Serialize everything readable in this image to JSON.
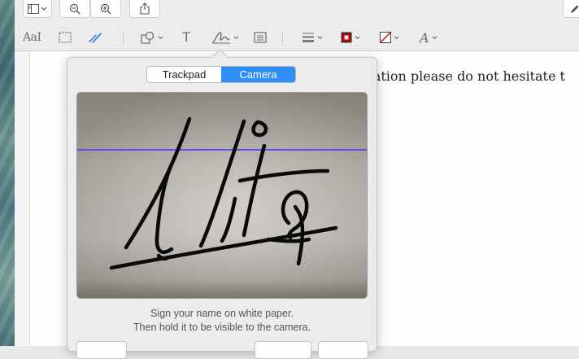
{
  "icons": {
    "sidebar": "sidebar-icon",
    "zoom_out": "zoom-out-icon",
    "zoom_in": "zoom-in-icon",
    "share": "share-icon",
    "edit": "pencil-icon",
    "text_style": "text-style-icon",
    "selection": "rectangle-selection-icon",
    "sketch": "sketch-icon",
    "shapes": "shapes-icon",
    "text": "text-icon",
    "sign": "signature-icon",
    "note": "note-icon",
    "line_style": "line-style-icon",
    "border_color": "border-color-icon",
    "fill_color": "fill-color-icon",
    "font": "font-icon"
  },
  "markup_toolbar": {
    "text_style_label": "AaI",
    "text_tool_label": "T",
    "font_label": "A"
  },
  "colors": {
    "accent": "#2f8ef7",
    "border_color": "#c00000",
    "sketch": "#2f6fe0",
    "camera_guide": "#5b4ff0"
  },
  "document": {
    "visible_text": "rmation please do not hesitate t"
  },
  "signature_popover": {
    "tabs": [
      "Trackpad",
      "Camera"
    ],
    "selected_tab": "Camera",
    "instruction_line1": "Sign your name on white paper.",
    "instruction_line2": "Then hold it to be visible to the camera."
  }
}
